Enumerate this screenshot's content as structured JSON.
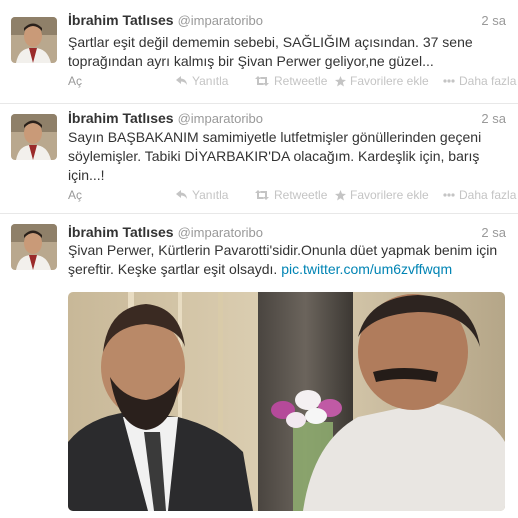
{
  "tweets": [
    {
      "name": "İbrahim Tatlıses",
      "handle": "@imparatoribo",
      "time": "2 sa",
      "text": "Şartlar eşit değil dememin sebebi, SAĞLIĞIM açısından. 37 sene toprağından ayrı kalmış bir Şivan Perwer geliyor,ne güzel...",
      "open": "Aç",
      "reply": "Yanıtla",
      "retweet": "Retweetle",
      "favorite": "Favorilere ekle",
      "more": "Daha fazla"
    },
    {
      "name": "İbrahim Tatlıses",
      "handle": "@imparatoribo",
      "time": "2 sa",
      "text": "Sayın BAŞBAKANIM samimiyetle lutfetmişler gönüllerinden geçeni söylemişler. Tabiki DİYARBAKIR'DA olacağım. Kardeşlik için, barış için...!",
      "open": "Aç",
      "reply": "Yanıtla",
      "retweet": "Retweetle",
      "favorite": "Favorilere ekle",
      "more": "Daha fazla"
    },
    {
      "name": "İbrahim Tatlıses",
      "handle": "@imparatoribo",
      "time": "2 sa",
      "text": "Şivan Perwer, Kürtlerin Pavarotti'sidir.Onunla düet yapmak benim için şereftir. Keşke şartlar eşit olsaydı.",
      "link": "pic.twitter.com/um6zvffwqm"
    }
  ],
  "colors": {
    "link": "#0084b4",
    "meta": "#999999",
    "action": "#c4c4c4"
  },
  "icons": [
    "reply-icon",
    "retweet-icon",
    "star-icon",
    "more-icon"
  ]
}
